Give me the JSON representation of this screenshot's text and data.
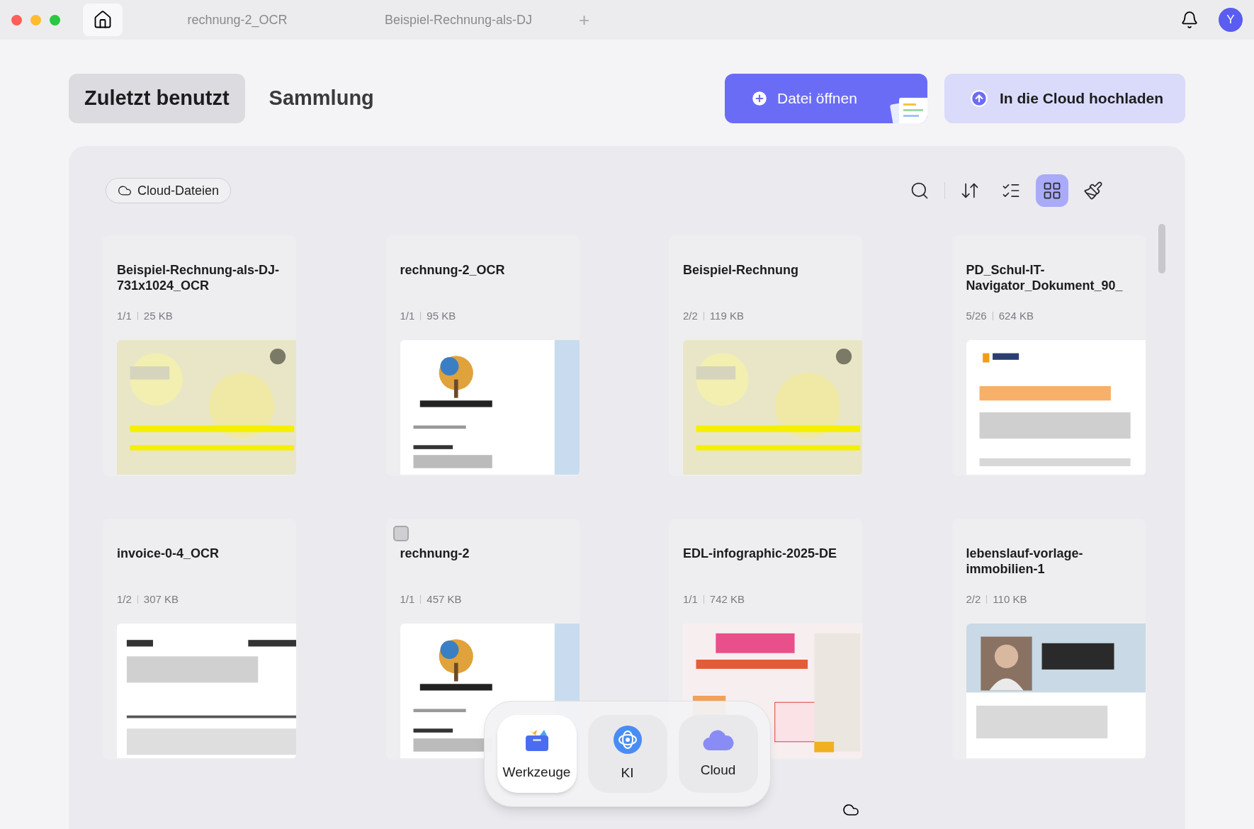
{
  "titlebar": {
    "home": {
      "selected": true
    },
    "tabs": [
      {
        "label": "rechnung-2_OCR",
        "selected": false
      },
      {
        "label": "Beispiel-Rechnung-als-DJ",
        "selected": false
      }
    ],
    "new_tab": "+",
    "avatar": "Y"
  },
  "view_tabs": [
    {
      "label": "Zuletzt benutzt",
      "selected": true
    },
    {
      "label": "Sammlung",
      "selected": false
    }
  ],
  "actions": [
    {
      "label": "Datei öffnen",
      "kind": "primary"
    },
    {
      "label": "In die Cloud hochladen",
      "kind": "secondary"
    }
  ],
  "filter": {
    "label": "Cloud-Dateien"
  },
  "toolbar": [
    {
      "kind": "search",
      "selected": false
    },
    {
      "kind": "sort",
      "selected": false
    },
    {
      "kind": "list",
      "selected": false
    },
    {
      "kind": "grid",
      "selected": true
    },
    {
      "kind": "clean",
      "selected": false
    }
  ],
  "files": [
    {
      "name": "Beispiel-Rechnung-als-DJ-731x1024_OCR",
      "pages": "1/1",
      "size": "25 KB",
      "hovered": false
    },
    {
      "name": "rechnung-2_OCR",
      "pages": "1/1",
      "size": "95 KB",
      "hovered": false
    },
    {
      "name": "Beispiel-Rechnung",
      "pages": "2/2",
      "size": "119 KB",
      "hovered": false
    },
    {
      "name": "PD_Schul-IT-Navigator_Dokument_90_",
      "pages": "5/26",
      "size": "624 KB",
      "hovered": false
    },
    {
      "name": "invoice-0-4_OCR",
      "pages": "1/2",
      "size": "307 KB",
      "hovered": false
    },
    {
      "name": "rechnung-2",
      "pages": "1/1",
      "size": "457 KB",
      "hovered": true
    },
    {
      "name": "EDL-infographic-2025-DE",
      "pages": "1/1",
      "size": "742 KB",
      "hovered": false
    },
    {
      "name": "lebenslauf-vorlage-immobilien-1",
      "pages": "2/2",
      "size": "110 KB",
      "hovered": false
    }
  ],
  "dock": [
    {
      "label": "Werkzeuge",
      "kind": "tools",
      "selected": true
    },
    {
      "label": "KI",
      "kind": "ai",
      "selected": false
    },
    {
      "label": "Cloud",
      "kind": "cloud",
      "selected": false
    }
  ]
}
